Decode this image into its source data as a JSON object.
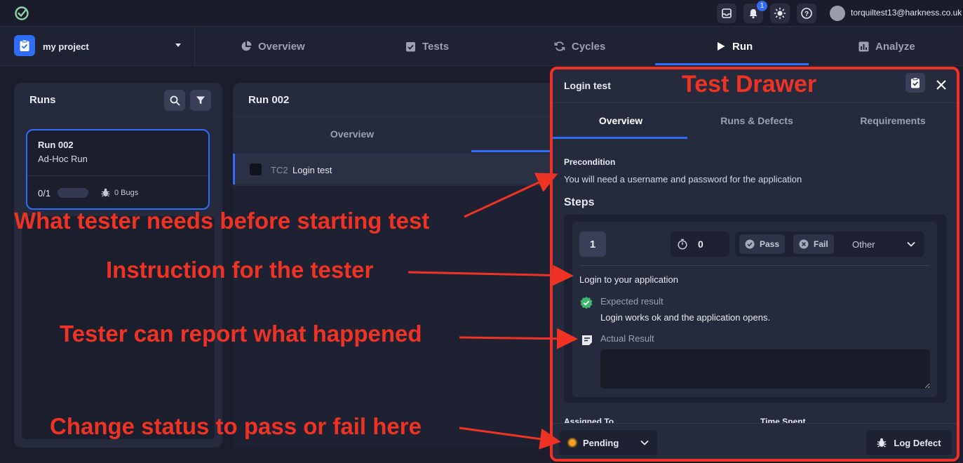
{
  "topbar": {
    "notification_count": "1",
    "user_email": "torquiltest13@harkness.co.uk"
  },
  "navbar": {
    "project_name": "my project",
    "tabs": [
      {
        "label": "Overview",
        "icon": "pie-chart-icon"
      },
      {
        "label": "Tests",
        "icon": "clipboard-check-icon"
      },
      {
        "label": "Cycles",
        "icon": "refresh-icon"
      },
      {
        "label": "Run",
        "icon": "play-icon",
        "active": true
      },
      {
        "label": "Analyze",
        "icon": "bar-chart-icon"
      }
    ]
  },
  "runs_panel": {
    "title": "Runs",
    "card": {
      "title": "Run 002",
      "subtitle": "Ad-Hoc Run",
      "progress": "0/1",
      "progress_fraction": 0,
      "bugs": "0 Bugs"
    }
  },
  "middle_panel": {
    "title": "Run 002",
    "tab": "Overview",
    "test_case": {
      "id": "TC2",
      "name": "Login test"
    }
  },
  "drawer": {
    "title": "Login test",
    "banner": "Test Drawer",
    "tabs": [
      "Overview",
      "Runs & Defects",
      "Requirements"
    ],
    "precondition_label": "Precondition",
    "precondition_text": "You will need a username and password for the application",
    "steps_label": "Steps",
    "step": {
      "number": "1",
      "timer": "0",
      "pass_label": "Pass",
      "fail_label": "Fail",
      "other_label": "Other",
      "instruction": "Login to your application",
      "expected_label": "Expected result",
      "expected_text": "Login works ok and the application opens.",
      "actual_label": "Actual Result",
      "actual_value": ""
    },
    "assigned_label": "Assigned To",
    "time_spent_label": "Time Spent",
    "status_value": "Pending",
    "log_defect_label": "Log Defect"
  },
  "annotations": {
    "precondition": "What tester needs before starting test",
    "instruction": "Instruction for the tester",
    "actual": "Tester can report what happened",
    "status": "Change status to pass or fail here"
  },
  "colors": {
    "accent": "#2f6df6",
    "annotation": "#ee3324",
    "pass": "#3fb56b",
    "pending": "#f0a12c"
  }
}
